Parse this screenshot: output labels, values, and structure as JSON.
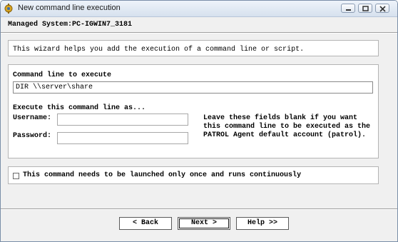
{
  "window": {
    "title": "New command line execution",
    "icon": "gear-app-icon",
    "controls": [
      "minimize-icon",
      "maximize-icon",
      "close-icon"
    ]
  },
  "header": {
    "managed_system": "Managed System:PC-IGWIN7_3181"
  },
  "intro": {
    "text": "This wizard helps you add the execution of a command line or script."
  },
  "command": {
    "label": "Command line to execute",
    "value": "DIR \\\\server\\share"
  },
  "credentials": {
    "heading": "Execute this command line as...",
    "username_label": "Username:",
    "username_value": "",
    "password_label": "Password:",
    "password_value": "",
    "help": "Leave these fields blank if you want this command line to be executed as the PATROL Agent default account (patrol)."
  },
  "options": {
    "run_once_label": "This command needs to be launched only once and runs continuously",
    "run_once_checked": false
  },
  "buttons": {
    "back": "< Back",
    "next": "Next >",
    "help": "Help >>"
  }
}
